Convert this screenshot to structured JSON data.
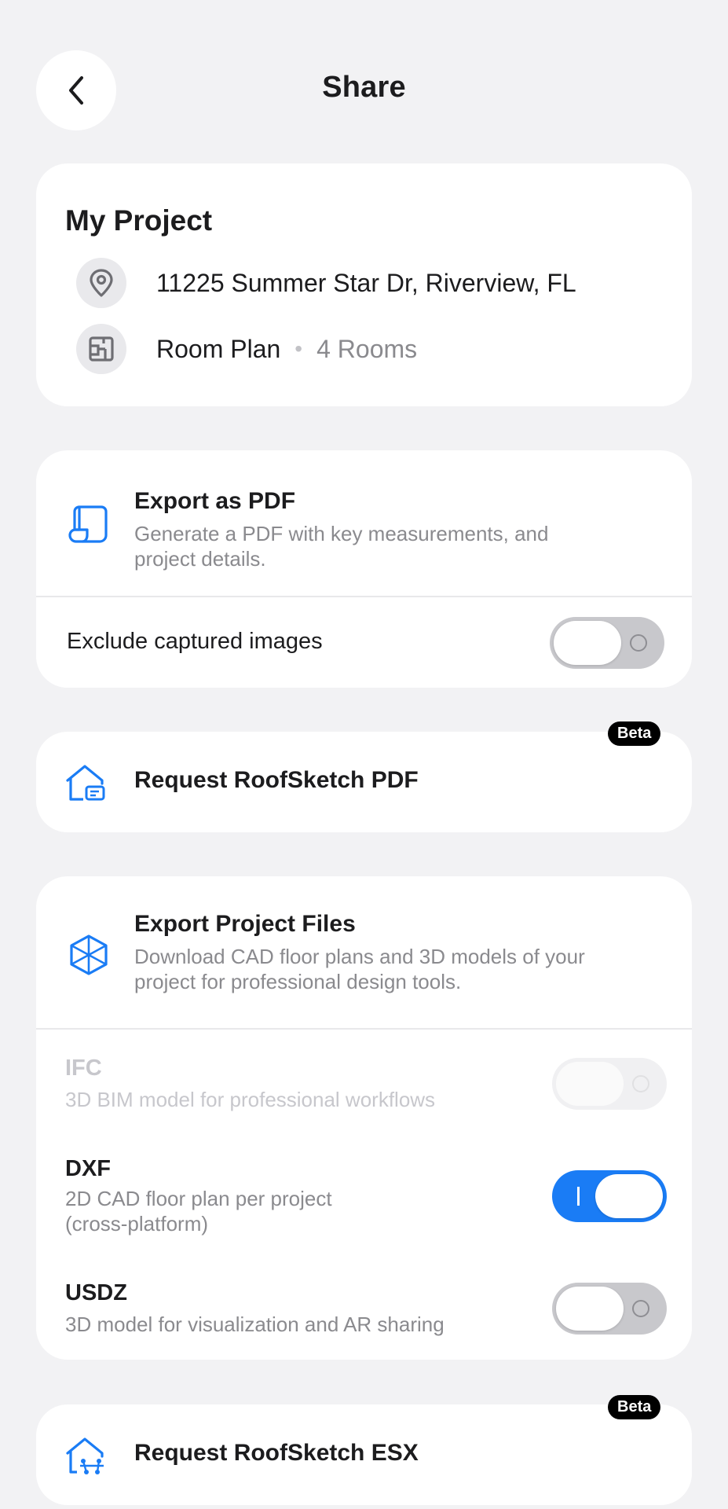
{
  "header": {
    "title": "Share",
    "back_icon": "chevron-left-icon"
  },
  "project": {
    "name": "My Project",
    "address": "11225 Summer Star Dr, Riverview, FL",
    "plan_type": "Room Plan",
    "room_count": "4 Rooms",
    "icons": {
      "address": "location-pin-icon",
      "plan": "floor-plan-icon"
    }
  },
  "pdf_export": {
    "title": "Export as PDF",
    "description": "Generate a PDF with key measurements, and project details.",
    "exclude_images_label": "Exclude captured images",
    "exclude_images_enabled": false,
    "icon": "document-scroll-icon"
  },
  "roofsketch_pdf": {
    "title": "Request RoofSketch PDF",
    "badge": "Beta",
    "icon": "house-document-icon"
  },
  "project_files": {
    "title": "Export Project Files",
    "description": "Download CAD floor plans and 3D models of your project for professional design tools.",
    "icon": "cube-icon",
    "formats": [
      {
        "name": "IFC",
        "description": "3D BIM model for professional workflows",
        "enabled": false,
        "disabled": true
      },
      {
        "name": "DXF",
        "description": "2D CAD floor plan per project (cross-platform)",
        "enabled": true,
        "disabled": false
      },
      {
        "name": "USDZ",
        "description": "3D model for visualization and AR sharing",
        "enabled": false,
        "disabled": false
      }
    ]
  },
  "roofsketch_esx": {
    "title": "Request RoofSketch ESX",
    "badge": "Beta",
    "icon": "house-network-icon"
  },
  "colors": {
    "accent": "#1a7cf5",
    "background": "#f2f2f4",
    "card": "#ffffff",
    "muted_text": "#8a8a8e",
    "toggle_off": "#c8c8cc"
  }
}
